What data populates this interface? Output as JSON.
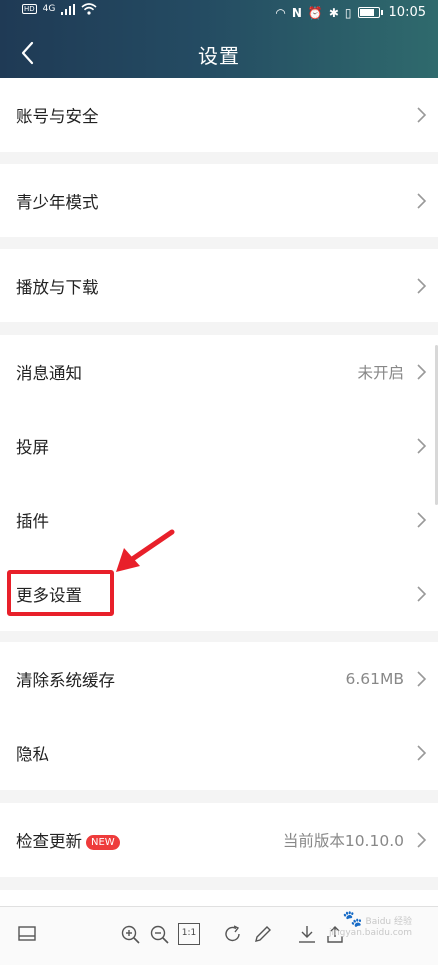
{
  "status_bar": {
    "time": "10:05",
    "network": "4G"
  },
  "header": {
    "title": "设置"
  },
  "settings": {
    "account_security": "账号与安全",
    "teen_mode": "青少年模式",
    "play_download": "播放与下载",
    "notifications": {
      "label": "消息通知",
      "value": "未开启"
    },
    "cast": "投屏",
    "plugins": "插件",
    "more_settings": "更多设置",
    "clear_cache": {
      "label": "清除系统缓存",
      "value": "6.61MB"
    },
    "privacy": "隐私",
    "check_update": {
      "label": "检查更新",
      "badge": "NEW",
      "value": "当前版本10.10.0"
    }
  },
  "annotation": {
    "highlight_color": "#e8202a",
    "highlighted_item": "更多设置"
  },
  "toolbar": {
    "icons": [
      "layout-icon",
      "zoom-in-icon",
      "zoom-out-icon",
      "actual-size-icon",
      "rotate-icon",
      "edit-icon",
      "download-icon",
      "share-icon"
    ],
    "actual_size_label": "1:1"
  },
  "watermark": {
    "brand": "Baidu 经验",
    "url": "jingyan.baidu.com"
  },
  "colors": {
    "header_gradient_start": "#1f3a55",
    "header_gradient_end": "#2f6a6d",
    "badge_red": "#ee3b3b"
  }
}
